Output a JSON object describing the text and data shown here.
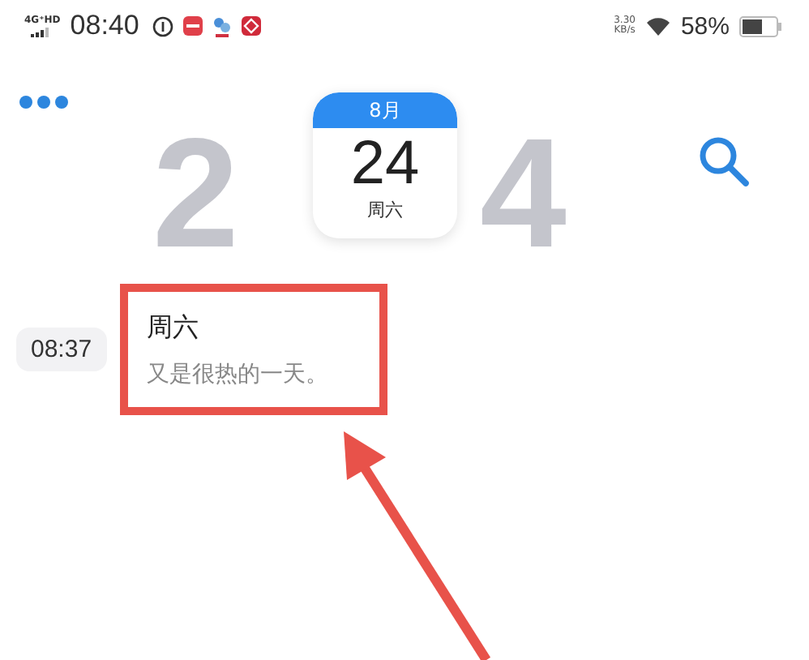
{
  "status_bar": {
    "network": "4G⁺HD",
    "time": "08:40",
    "speed": "3.30",
    "speed_unit": "KB/s",
    "battery": "58%"
  },
  "header": {
    "year_digits": [
      "2",
      "4"
    ],
    "calendar": {
      "month": "8月",
      "day": "24",
      "weekday": "周六"
    }
  },
  "entries": [
    {
      "time": "08:37",
      "title": "周六",
      "body": "又是很热的一天。",
      "highlighted": true
    }
  ]
}
